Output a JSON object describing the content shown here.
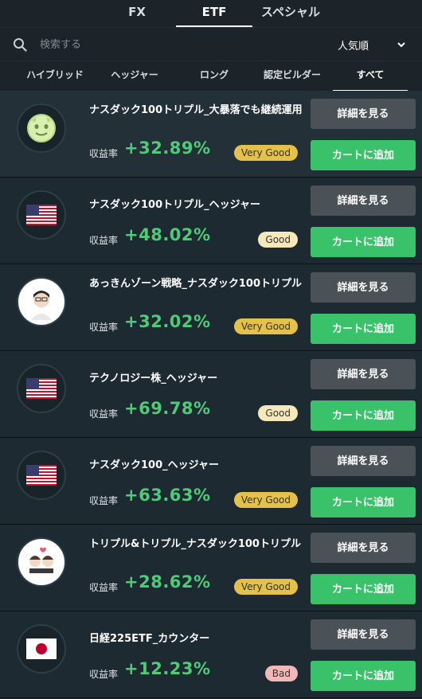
{
  "top_tabs": [
    {
      "label": "FX"
    },
    {
      "label": "ETF"
    },
    {
      "label": "スペシャル"
    }
  ],
  "search": {
    "placeholder": "検索する",
    "sort_label": "人気順"
  },
  "filter_tabs": [
    {
      "label": "ハイブリッド"
    },
    {
      "label": "ヘッジャー"
    },
    {
      "label": "ロング"
    },
    {
      "label": "認定ビルダー"
    },
    {
      "label": "すべて"
    }
  ],
  "common": {
    "return_label": "収益率",
    "detail_button": "詳細を見る",
    "cart_button": "カートに追加"
  },
  "products": [
    {
      "title": "ナスダック100トリプル_大暴落でも継続運用",
      "return": "+32.89%",
      "badge": "Very Good",
      "icon": "green-mascot-icon"
    },
    {
      "title": "ナスダック100トリプル_ヘッジャー",
      "return": "+48.02%",
      "badge": "Good",
      "icon": "us-flag-icon"
    },
    {
      "title": "あっきんゾーン戦略_ナスダック100トリプル",
      "return": "+32.02%",
      "badge": "Very Good",
      "icon": "person-avatar-icon"
    },
    {
      "title": "テクノロジー株_ヘッジャー",
      "return": "+69.78%",
      "badge": "Good",
      "icon": "us-flag-icon"
    },
    {
      "title": "ナスダック100_ヘッジャー",
      "return": "+63.63%",
      "badge": "Very Good",
      "icon": "us-flag-icon"
    },
    {
      "title": "トリプル&トリプル_ナスダック100トリプル",
      "return": "+28.62%",
      "badge": "Very Good",
      "icon": "couple-avatar-icon"
    },
    {
      "title": "日経225ETF_カウンター",
      "return": "+12.23%",
      "badge": "Bad",
      "icon": "japan-flag-icon"
    }
  ],
  "colors": {
    "accent_green": "#3ac26a",
    "return_green": "#4ecb77",
    "very_good_badge": "#e3c14a",
    "good_badge": "#f6e8b8",
    "bad_badge": "#f2b8b8"
  }
}
